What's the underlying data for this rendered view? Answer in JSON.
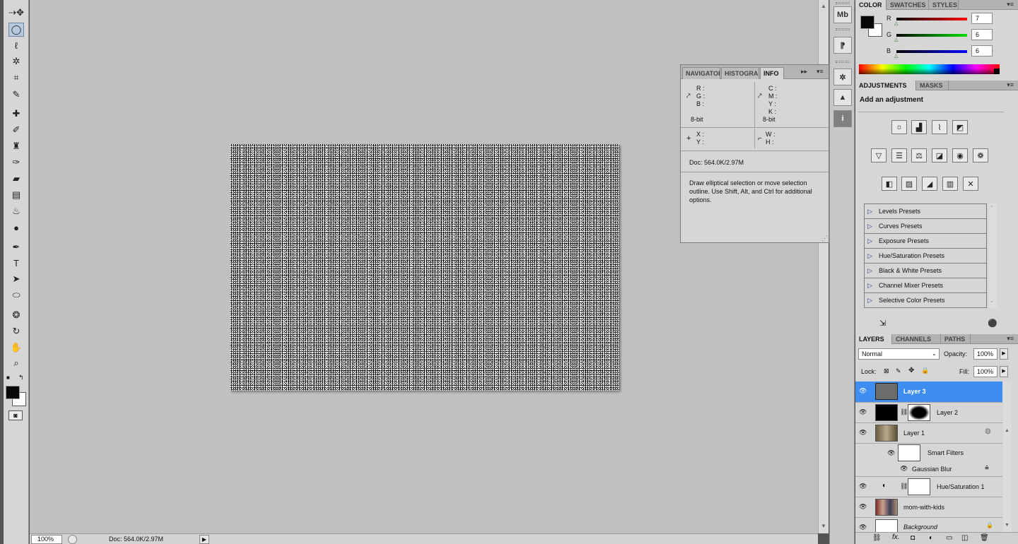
{
  "toolbar": {
    "tools": [
      {
        "name": "move-tool",
        "glyph": "▸✥"
      },
      {
        "name": "elliptical-marquee-tool",
        "glyph": "◯",
        "active": true
      },
      {
        "name": "lasso-tool",
        "glyph": "ꝺ"
      },
      {
        "name": "magic-wand-tool",
        "glyph": "✲"
      },
      {
        "name": "crop-tool",
        "glyph": "⌗"
      },
      {
        "name": "eyedropper-tool",
        "glyph": "✎"
      },
      {
        "name": "healing-brush-tool",
        "glyph": "✚"
      },
      {
        "name": "brush-tool",
        "glyph": "✐"
      },
      {
        "name": "clone-stamp-tool",
        "glyph": "♜"
      },
      {
        "name": "history-brush-tool",
        "glyph": "✑"
      },
      {
        "name": "eraser-tool",
        "glyph": "▰"
      },
      {
        "name": "gradient-tool",
        "glyph": "▤"
      },
      {
        "name": "blur-tool",
        "glyph": "♨"
      },
      {
        "name": "dodge-tool",
        "glyph": "●"
      },
      {
        "name": "pen-tool",
        "glyph": "✒"
      },
      {
        "name": "type-tool",
        "glyph": "T"
      },
      {
        "name": "path-selection-tool",
        "glyph": "➤"
      },
      {
        "name": "ellipse-shape-tool",
        "glyph": "⬭"
      },
      {
        "name": "3d-rotate-tool",
        "glyph": "❂"
      },
      {
        "name": "3d-orbit-tool",
        "glyph": "↻"
      },
      {
        "name": "hand-tool",
        "glyph": "✋"
      },
      {
        "name": "zoom-tool",
        "glyph": "🔍"
      }
    ]
  },
  "statusbar": {
    "zoom": "100%",
    "doc": "Doc: 564.0K/2.97M"
  },
  "info_panel": {
    "tabs": [
      "NAVIGATOR",
      "HISTOGRAM",
      "INFO"
    ],
    "rgb_labels": [
      "R :",
      "G :",
      "B :"
    ],
    "cmyk_labels": [
      "C :",
      "M :",
      "Y :",
      "K :"
    ],
    "bitdepth_left": "8-bit",
    "bitdepth_right": "8-bit",
    "xy_labels": [
      "X :",
      "Y :"
    ],
    "wh_labels": [
      "W :",
      "H :"
    ],
    "doc": "Doc: 564.0K/2.97M",
    "hint": "Draw elliptical selection or move selection outline.  Use Shift, Alt, and Ctrl for additional options."
  },
  "color_panel": {
    "tabs": [
      "COLOR",
      "SWATCHES",
      "STYLES"
    ],
    "channels": [
      {
        "label": "R",
        "value": "7",
        "bar": "#ff0000"
      },
      {
        "label": "G",
        "value": "6",
        "bar": "#00c000"
      },
      {
        "label": "B",
        "value": "6",
        "bar": "#0000ff"
      }
    ]
  },
  "adjustments_panel": {
    "tabs": [
      "ADJUSTMENTS",
      "MASKS"
    ],
    "heading": "Add an adjustment",
    "presets": [
      "Levels Presets",
      "Curves Presets",
      "Exposure Presets",
      "Hue/Saturation Presets",
      "Black & White Presets",
      "Channel Mixer Presets",
      "Selective Color Presets"
    ]
  },
  "layers_panel": {
    "tabs": [
      "LAYERS",
      "CHANNELS",
      "PATHS"
    ],
    "blend_mode": "Normal",
    "opacity_label": "Opacity:",
    "opacity": "100%",
    "lock_label": "Lock:",
    "fill_label": "Fill:",
    "fill": "100%",
    "layers": [
      {
        "name": "Layer 3",
        "selected": true
      },
      {
        "name": "Layer 2"
      },
      {
        "name": "Layer 1"
      },
      {
        "name": "Smart Filters"
      },
      {
        "name": "Gaussian Blur"
      },
      {
        "name": "Hue/Saturation 1"
      },
      {
        "name": "mom-with-kids"
      },
      {
        "name": "Background"
      }
    ]
  },
  "dock": {
    "buttons": [
      "mini-bridge",
      "character",
      "3d",
      "navigator",
      "info"
    ]
  }
}
